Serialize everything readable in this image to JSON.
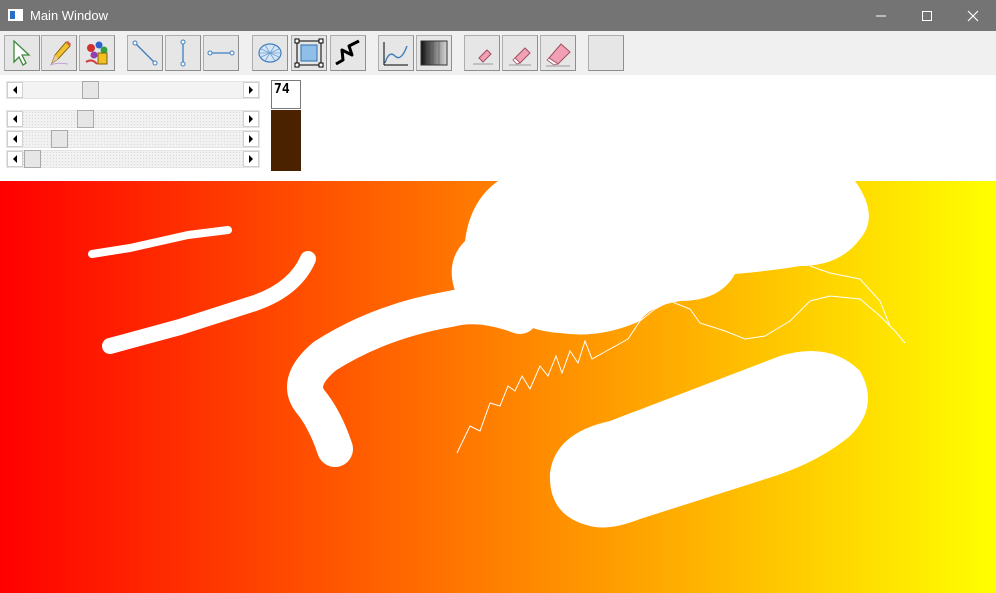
{
  "window": {
    "title": "Main Window",
    "controls": {
      "minimize": "minimize-icon",
      "maximize": "maximize-icon",
      "close": "close-icon"
    }
  },
  "toolbar": {
    "tools": [
      {
        "name": "select-tool",
        "icon": "arrow-cursor-icon"
      },
      {
        "name": "pencil-tool",
        "icon": "pencil-icon"
      },
      {
        "name": "paint-tool",
        "icon": "paint-bucket-icon"
      },
      {
        "name": "diagonal-line-tool",
        "icon": "diagonal-line-icon"
      },
      {
        "name": "vertical-line-tool",
        "icon": "vertical-line-icon"
      },
      {
        "name": "horizontal-line-tool",
        "icon": "horizontal-line-icon"
      },
      {
        "name": "mesh-tool",
        "icon": "mesh-icon"
      },
      {
        "name": "rectangle-select-tool",
        "icon": "rectangle-select-icon"
      },
      {
        "name": "zigzag-tool",
        "icon": "zigzag-icon"
      },
      {
        "name": "curve-tool",
        "icon": "curve-icon"
      },
      {
        "name": "gradient-tool",
        "icon": "gradient-icon"
      },
      {
        "name": "small-eraser-tool",
        "icon": "eraser-icon"
      },
      {
        "name": "medium-eraser-tool",
        "icon": "eraser-icon"
      },
      {
        "name": "large-eraser-tool",
        "icon": "eraser-icon"
      },
      {
        "name": "blank-tool",
        "icon": ""
      }
    ]
  },
  "controls": {
    "brush_size": "74",
    "sliders": [
      {
        "name": "brush-size-slider",
        "value_fraction": 0.3
      },
      {
        "name": "red-slider",
        "value_fraction": 0.29
      },
      {
        "name": "green-slider",
        "value_fraction": 0.14
      },
      {
        "name": "blue-slider",
        "value_fraction": 0.0
      }
    ],
    "current_color": "#4a2200"
  },
  "canvas": {
    "gradient_colors": [
      "#ff0000",
      "#ff8000",
      "#ffff00"
    ],
    "stroke_color": "#ffffff"
  }
}
